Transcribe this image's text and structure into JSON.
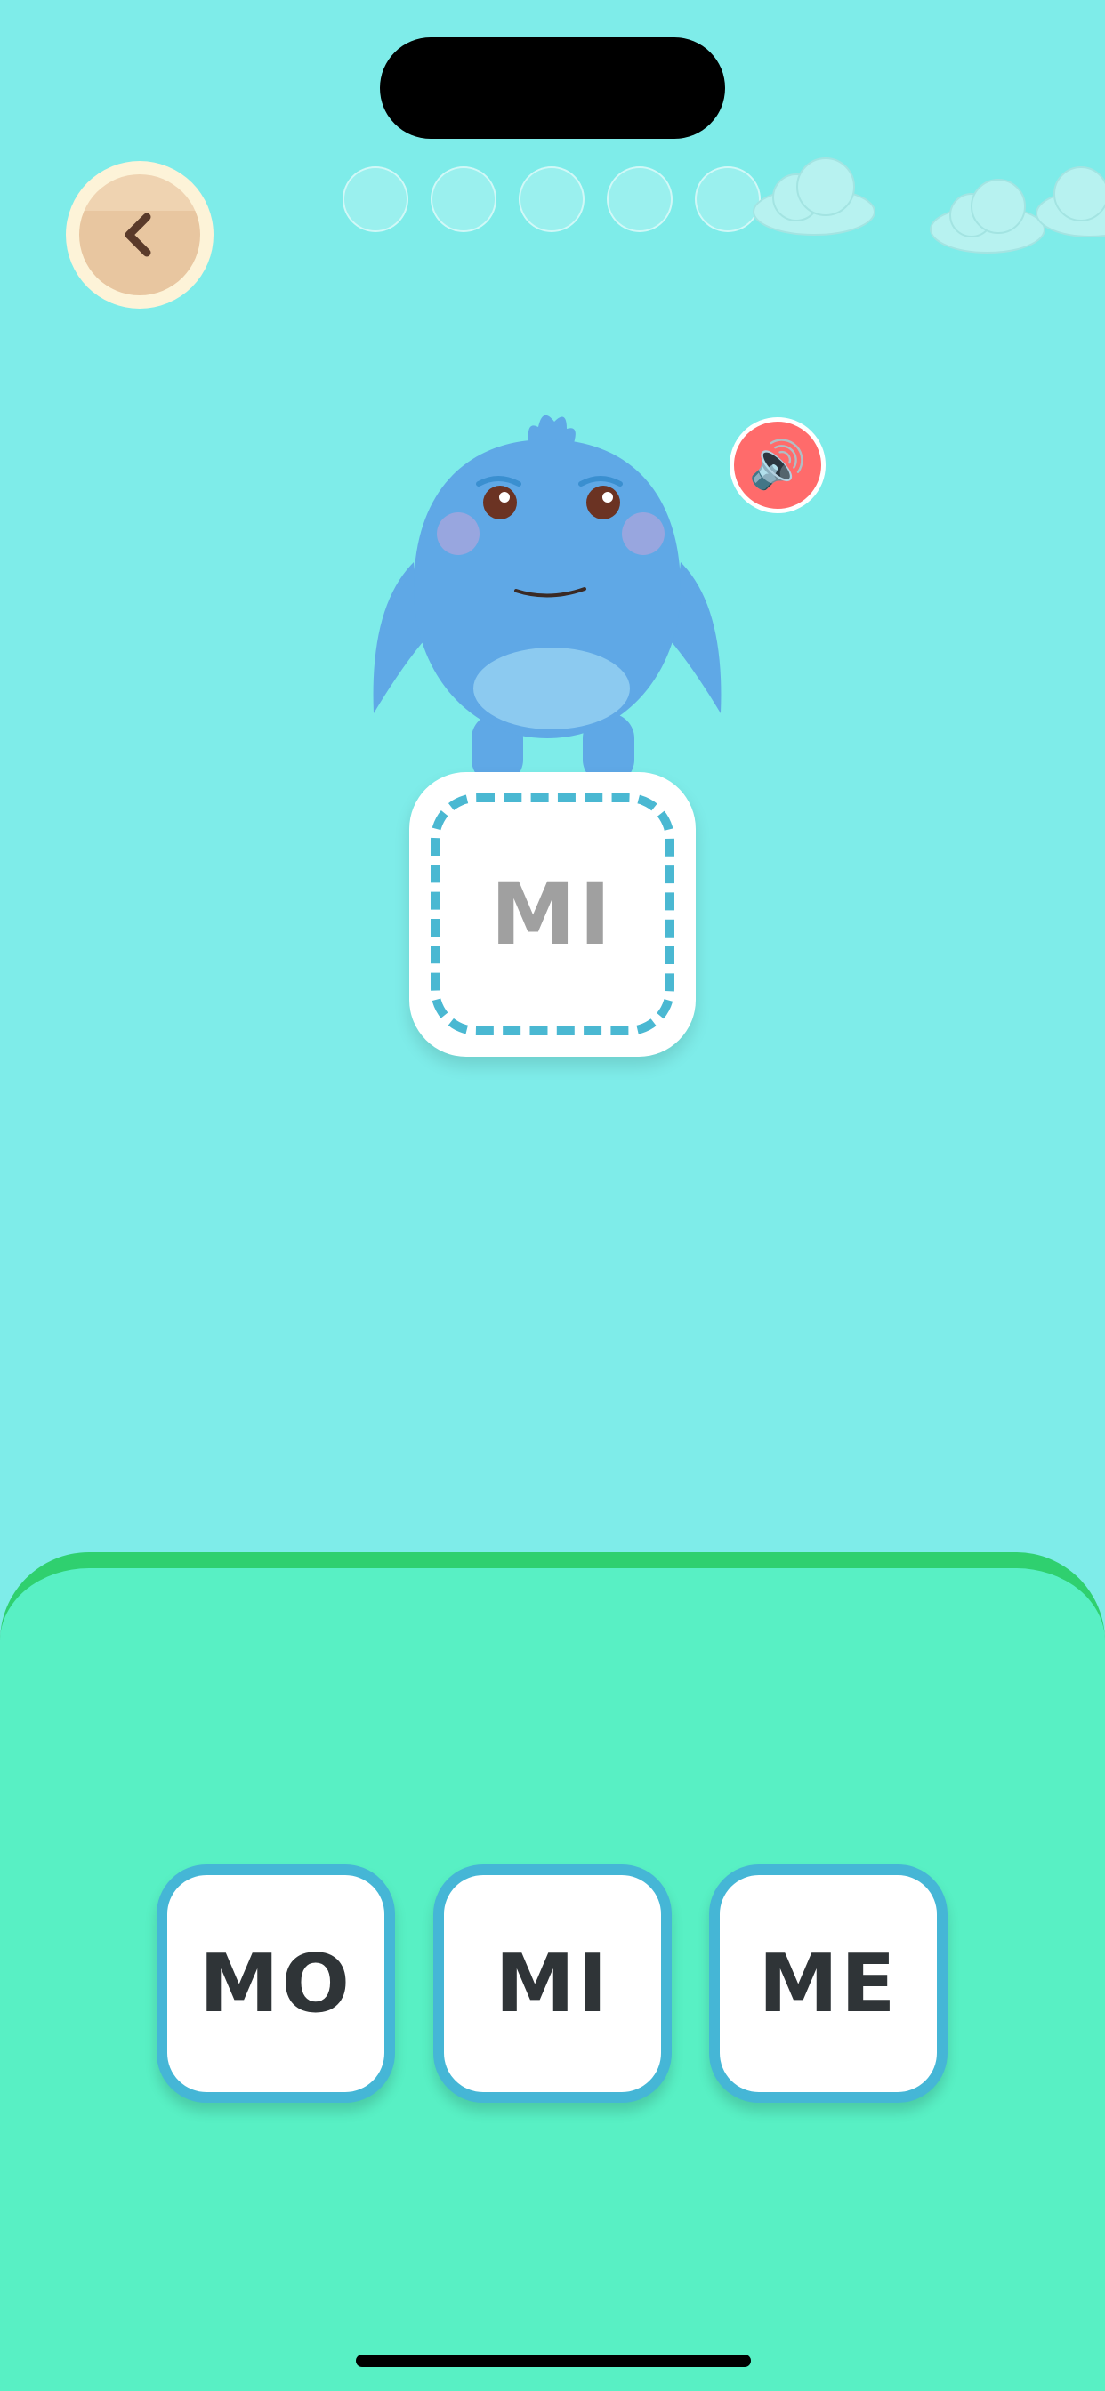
{
  "colors": {
    "sky": "#7eece9",
    "ground": "#58f0c4",
    "ground_edge": "#2fd06f",
    "choice_border": "#45b6d6",
    "target_dash": "#4ab8d2",
    "sound_button": "#ff6b6b"
  },
  "header": {
    "back_icon": "chevron-left-icon",
    "progress_total": 5,
    "progress_completed": 0
  },
  "mascot": {
    "name_icon": "blue-monster-character"
  },
  "sound": {
    "icon": "speaker-icon",
    "glyph": "🔊"
  },
  "target": {
    "syllable": "MI"
  },
  "choices": [
    {
      "label": "MO"
    },
    {
      "label": "MI"
    },
    {
      "label": "ME"
    }
  ]
}
